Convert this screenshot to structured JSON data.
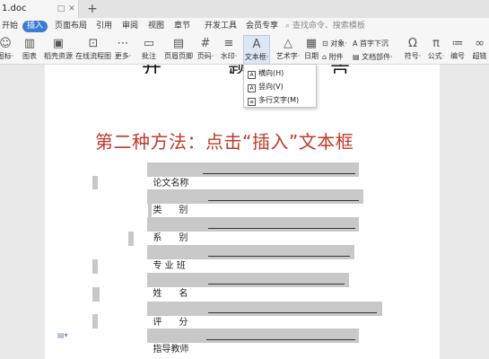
{
  "titlebar": {
    "doc_tab": "1.doc",
    "new_tab": "+",
    "pin": "□",
    "close": "✕"
  },
  "menubar": {
    "items": [
      "开始",
      "插入",
      "页面布局",
      "引用",
      "审阅",
      "视图",
      "章节",
      "开发工具",
      "会员专享"
    ],
    "active_index": 1,
    "search_placeholder": "查找命令、搜索模板"
  },
  "ribbon": {
    "buttons": [
      {
        "label": "图标·",
        "icon": "icons-icon"
      },
      {
        "label": "图表",
        "icon": "chart-icon"
      },
      {
        "label": "稻壳资源",
        "icon": "resource-icon"
      },
      {
        "label": "在线流程图",
        "icon": "flowchart-icon"
      },
      {
        "label": "更多·",
        "icon": "more-icon"
      },
      {
        "label": "批注",
        "icon": "comment-icon"
      },
      {
        "label": "页眉页脚",
        "icon": "header-footer-icon"
      },
      {
        "label": "页码·",
        "icon": "page-number-icon"
      },
      {
        "label": "水印·",
        "icon": "watermark-icon"
      },
      {
        "label": "文本框·",
        "icon": "textbox-icon"
      },
      {
        "label": "艺术字·",
        "icon": "wordart-icon"
      },
      {
        "label": "日期",
        "icon": "date-icon"
      }
    ],
    "small": {
      "object": "对象·",
      "dropcap": "首字下沉",
      "attachment": "附件",
      "docpart": "文档部件·"
    },
    "right_buttons": [
      {
        "label": "符号·",
        "icon": "symbol-icon"
      },
      {
        "label": "公式·",
        "icon": "formula-icon"
      },
      {
        "label": "编号",
        "icon": "numbering-icon"
      },
      {
        "label": "超链",
        "icon": "link-icon"
      }
    ]
  },
  "dropdown": {
    "items": [
      "横向(H)",
      "竖向(V)",
      "多行文字(M)"
    ]
  },
  "document": {
    "top_chars": [
      "开",
      "题",
      "告"
    ],
    "heading": "第二种方法：点击“插入”文本框",
    "fields": [
      "论文名称",
      "类      别",
      "系      别",
      "专 业 班",
      "姓      名",
      "评      分",
      "指导教师"
    ]
  }
}
